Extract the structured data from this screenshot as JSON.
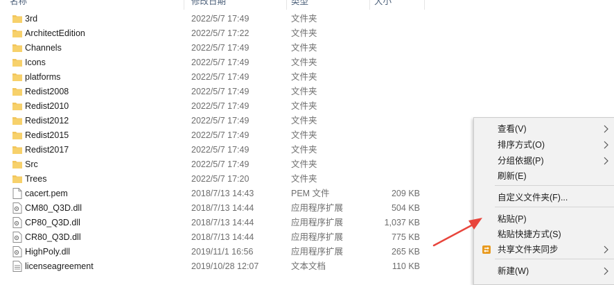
{
  "header": {
    "name": "名称",
    "date": "修改日期",
    "type": "类型",
    "size": "大小"
  },
  "files": [
    {
      "name": "3rd",
      "date": "2022/5/7 17:49",
      "type": "文件夹",
      "size": "",
      "icon": "folder-icon"
    },
    {
      "name": "ArchitectEdition",
      "date": "2022/5/7 17:22",
      "type": "文件夹",
      "size": "",
      "icon": "folder-icon"
    },
    {
      "name": "Channels",
      "date": "2022/5/7 17:49",
      "type": "文件夹",
      "size": "",
      "icon": "folder-icon"
    },
    {
      "name": "Icons",
      "date": "2022/5/7 17:49",
      "type": "文件夹",
      "size": "",
      "icon": "folder-icon"
    },
    {
      "name": "platforms",
      "date": "2022/5/7 17:49",
      "type": "文件夹",
      "size": "",
      "icon": "folder-icon"
    },
    {
      "name": "Redist2008",
      "date": "2022/5/7 17:49",
      "type": "文件夹",
      "size": "",
      "icon": "folder-icon"
    },
    {
      "name": "Redist2010",
      "date": "2022/5/7 17:49",
      "type": "文件夹",
      "size": "",
      "icon": "folder-icon"
    },
    {
      "name": "Redist2012",
      "date": "2022/5/7 17:49",
      "type": "文件夹",
      "size": "",
      "icon": "folder-icon"
    },
    {
      "name": "Redist2015",
      "date": "2022/5/7 17:49",
      "type": "文件夹",
      "size": "",
      "icon": "folder-icon"
    },
    {
      "name": "Redist2017",
      "date": "2022/5/7 17:49",
      "type": "文件夹",
      "size": "",
      "icon": "folder-icon"
    },
    {
      "name": "Src",
      "date": "2022/5/7 17:49",
      "type": "文件夹",
      "size": "",
      "icon": "folder-icon"
    },
    {
      "name": "Trees",
      "date": "2022/5/7 17:20",
      "type": "文件夹",
      "size": "",
      "icon": "folder-icon"
    },
    {
      "name": "cacert.pem",
      "date": "2018/7/13 14:43",
      "type": "PEM 文件",
      "size": "209 KB",
      "icon": "file-icon"
    },
    {
      "name": "CM80_Q3D.dll",
      "date": "2018/7/13 14:44",
      "type": "应用程序扩展",
      "size": "504 KB",
      "icon": "dll-icon"
    },
    {
      "name": "CP80_Q3D.dll",
      "date": "2018/7/13 14:44",
      "type": "应用程序扩展",
      "size": "1,037 KB",
      "icon": "dll-icon"
    },
    {
      "name": "CR80_Q3D.dll",
      "date": "2018/7/13 14:44",
      "type": "应用程序扩展",
      "size": "775 KB",
      "icon": "dll-icon"
    },
    {
      "name": "HighPoly.dll",
      "date": "2019/11/1 16:56",
      "type": "应用程序扩展",
      "size": "265 KB",
      "icon": "dll-icon"
    },
    {
      "name": "licenseagreement",
      "date": "2019/10/28 12:07",
      "type": "文本文档",
      "size": "110 KB",
      "icon": "text-file-icon"
    }
  ],
  "context_menu": {
    "items": [
      {
        "label": "查看(V)",
        "submenu": true
      },
      {
        "label": "排序方式(O)",
        "submenu": true
      },
      {
        "label": "分组依据(P)",
        "submenu": true
      },
      {
        "label": "刷新(E)",
        "submenu": false
      },
      {
        "label": "自定义文件夹(F)...",
        "submenu": false
      },
      {
        "label": "粘贴(P)",
        "submenu": false
      },
      {
        "label": "粘贴快捷方式(S)",
        "submenu": false
      },
      {
        "label": "共享文件夹同步",
        "submenu": true,
        "icon": "share-sync-icon"
      },
      {
        "label": "新建(W)",
        "submenu": true
      }
    ]
  },
  "colors": {
    "folder": "#f2c55c",
    "accent_arrow": "#e8453c",
    "sync_icon": "#e89a1f"
  }
}
